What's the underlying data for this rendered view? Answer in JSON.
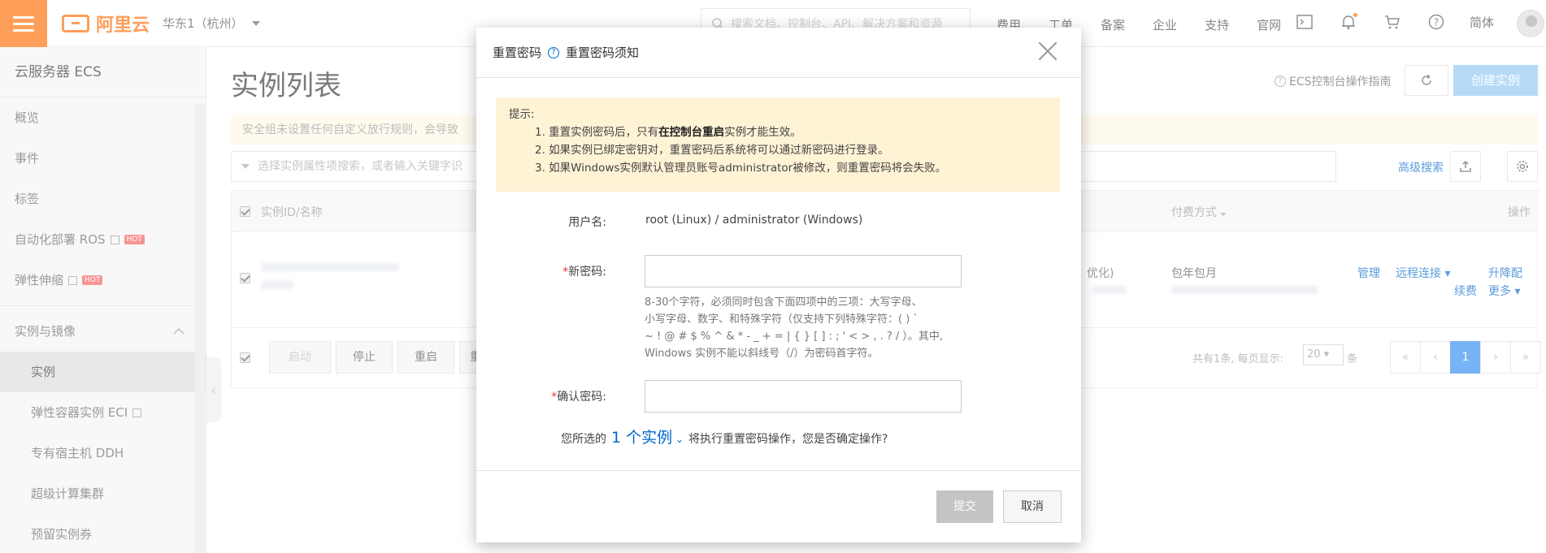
{
  "topbar": {
    "logo_text": "阿里云",
    "region": "华东1（杭州）",
    "search_placeholder": "搜索文档、控制台、API、解决方案和资源",
    "nav": [
      "费用",
      "工单",
      "备案",
      "企业",
      "支持",
      "官网"
    ],
    "lang": "简体"
  },
  "sidebar": {
    "title": "云服务器 ECS",
    "items": [
      {
        "label": "概览"
      },
      {
        "label": "事件"
      },
      {
        "label": "标签"
      },
      {
        "label": "自动化部署 ROS",
        "badge": "HOT"
      },
      {
        "label": "弹性伸缩",
        "badge": "HOT"
      }
    ],
    "group": "实例与镜像",
    "sub_items": [
      {
        "label": "实例"
      },
      {
        "label": "弹性容器实例 ECI"
      },
      {
        "label": "专有宿主机 DDH"
      },
      {
        "label": "超级计算集群"
      },
      {
        "label": "预留实例券"
      }
    ]
  },
  "main": {
    "title": "实例列表",
    "guide": "ECS控制台操作指南",
    "create_btn": "创建实例",
    "notice": "安全组未设置任何自定义放行规则，会导致",
    "filter_placeholder": "选择实例属性项搜索，或者输入关键字识",
    "advanced_search": "高级搜索",
    "table": {
      "col_instance": "实例ID/名称",
      "col_billing": "付费方式",
      "col_actions": "操作",
      "row": {
        "partial_text": "优化)",
        "billing": "包年包月",
        "actions": [
          "管理",
          "远程连接",
          "升降配",
          "续费",
          "更多"
        ]
      }
    },
    "footer": {
      "btn_start": "启动",
      "btn_stop": "停止",
      "btn_restart": "重启",
      "btn_partial": "重",
      "summary": "共有1条, 每页显示:",
      "page_size": "20",
      "unit": "条",
      "pager": [
        "«",
        "‹",
        "1",
        "›",
        "»"
      ]
    }
  },
  "modal": {
    "title": "重置密码",
    "help_link": "重置密码须知",
    "tips": {
      "heading": "提示:",
      "line1_a": "1. 重置实例密码后，只有",
      "line1_b": "在控制台重启",
      "line1_c": "实例才能生效。",
      "line2": "2. 如果实例已绑定密钥对，重置密码后系统将可以通过新密码进行登录。",
      "line3": "3. 如果Windows实例默认管理员账号administrator被修改，则重置密码将会失败。"
    },
    "username_label": "用户名:",
    "username_value": "root (Linux) / administrator (Windows)",
    "new_pw_label": "新密码:",
    "new_pw_value": "",
    "pw_hint_1": "8-30个字符，必须同时包含下面四项中的三项：大写字母、",
    "pw_hint_2": "小写字母、数字、和特殊字符（仅支持下列特殊字符：( ) `",
    "pw_hint_3": "~ ! @ # $ % ^ & * - _ + = | { } [ ] : ; ' < > , . ? / ）。其中,",
    "pw_hint_4": "Windows 实例不能以斜线号（/）为密码首字符。",
    "confirm_pw_label": "确认密码:",
    "confirm_pw_value": "",
    "confirm_prefix": "您所选的",
    "confirm_count": "1 个实例",
    "confirm_suffix": "将执行重置密码操作，您是否确定操作?",
    "submit": "提交",
    "cancel": "取消"
  },
  "colors": {
    "brand": "#ff6a00",
    "link": "#0066cc",
    "primary_disabled": "#8fc6f2",
    "tip_bg": "#fff3d5"
  },
  "icons": [
    "menu-icon",
    "search-icon",
    "terminal-icon",
    "bell-icon",
    "cart-icon",
    "help-icon",
    "refresh-icon",
    "export-icon",
    "settings-icon",
    "close-icon"
  ]
}
